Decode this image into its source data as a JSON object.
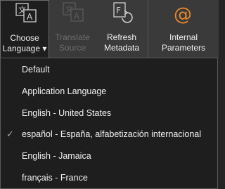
{
  "ribbon": {
    "choose_language": {
      "line1": "Choose",
      "line2": "Language",
      "caret": "▾"
    },
    "translate_source": {
      "line1": "Translate",
      "line2": "Source"
    },
    "refresh_metadata": {
      "line1": "Refresh",
      "line2": "Metadata"
    },
    "internal_parameters": {
      "line1": "Internal",
      "line2": "Parameters"
    }
  },
  "menu": {
    "items": [
      {
        "label": "Default",
        "checked": false
      },
      {
        "label": "Application Language",
        "checked": false
      },
      {
        "label": "English - United States",
        "checked": false
      },
      {
        "label": "español - España, alfabetización internacional",
        "checked": true
      },
      {
        "label": "English - Jamaica",
        "checked": false
      },
      {
        "label": "français - France",
        "checked": false
      }
    ],
    "check_glyph": "✓"
  },
  "colors": {
    "accent": "#e8862a",
    "ribbon_bg": "#3a3a3a",
    "menu_bg": "#1e1e1e"
  }
}
